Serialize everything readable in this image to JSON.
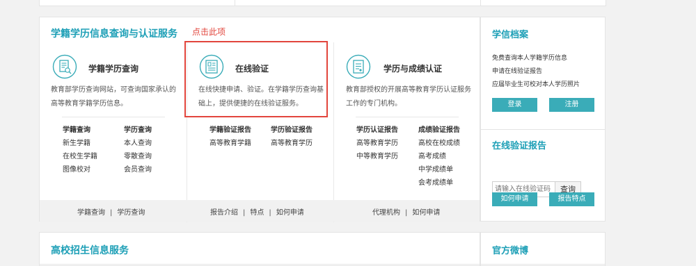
{
  "main": {
    "title": "学籍学历信息查询与认证服务",
    "click_hint": "点击此项",
    "services": [
      {
        "title": "学籍学历查询",
        "desc_lines": [
          "教育部学历查询网站，可查询国家承认的",
          "高等教育学籍学历信息。"
        ],
        "links": [
          {
            "head": "学籍查询",
            "items": [
              "新生学籍",
              "在校生学籍",
              "图像校对"
            ]
          },
          {
            "head": "学历查询",
            "items": [
              "本人查询",
              "零散查询",
              "会员查询"
            ]
          }
        ],
        "footer": [
          "学籍查询",
          "学历查询"
        ]
      },
      {
        "title": "在线验证",
        "desc_lines": [
          "在线快捷申请、验证。在学籍学历查询基",
          "础上，提供便捷的在线验证服务。"
        ],
        "links": [
          {
            "head": "学籍验证报告",
            "items": [
              "高等教育学籍"
            ]
          },
          {
            "head": "学历验证报告",
            "items": [
              "高等教育学历"
            ]
          }
        ],
        "footer": [
          "报告介绍",
          "特点",
          "如何申请"
        ]
      },
      {
        "title": "学历与成绩认证",
        "desc_lines": [
          "教育部授权的开展高等教育学历认证服务",
          "工作的专门机构。"
        ],
        "links": [
          {
            "head": "学历认证报告",
            "items": [
              "高等教育学历",
              "中等教育学历"
            ]
          },
          {
            "head": "成绩验证报告",
            "items": [
              "高校在校成绩",
              "高考成绩",
              "中学成绩单",
              "会考成绩单"
            ]
          }
        ],
        "footer": [
          "代理机构",
          "如何申请"
        ]
      }
    ],
    "footer_sep": "|"
  },
  "archive": {
    "title": "学信档案",
    "lines": [
      "免费查询本人学籍学历信息",
      "申请在线验证报告",
      "应届毕业生可校对本人学历照片"
    ],
    "login_label": "登录",
    "register_label": "注册"
  },
  "verify_report": {
    "title": "在线验证报告",
    "input_placeholder": "请输入在线验证码",
    "query_label": "查询",
    "how_apply_label": "如何申请",
    "features_label": "报告特点"
  },
  "admissions": {
    "title": "高校招生信息服务"
  },
  "weibo": {
    "title": "官方微博"
  },
  "colors": {
    "accent": "#1d9fb6",
    "button": "#3aacb8",
    "highlight": "#e2453c"
  }
}
